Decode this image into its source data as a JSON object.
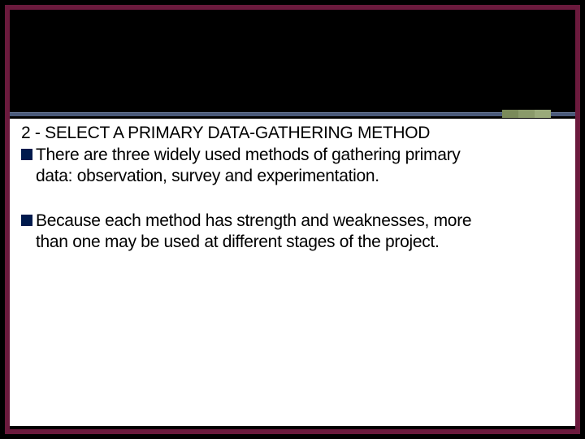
{
  "slide": {
    "heading": "2 - SELECT A PRIMARY DATA-GATHERING METHOD",
    "bullets": [
      {
        "firstLine": "There are three widely used methods of gathering primary",
        "continuation": "data: observation, survey and experimentation."
      },
      {
        "firstLine": "Because each method has strength and weaknesses, more",
        "continuation": "than one may be used at different stages of the project."
      }
    ]
  }
}
